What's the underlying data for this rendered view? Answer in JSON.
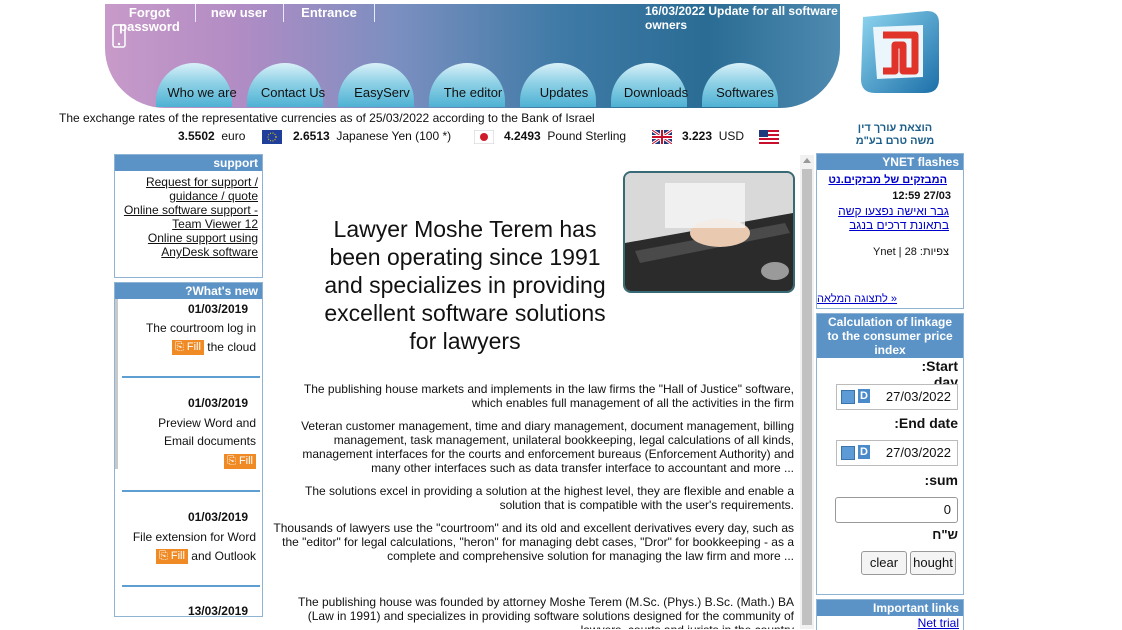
{
  "top_links": {
    "forgot_password": "Forgot password",
    "new_user": "new user",
    "entrance": "Entrance"
  },
  "update_notice": "16/03/2022 Update for all software owners",
  "tabs": [
    "Who we are",
    "Contact Us",
    "EasyServ",
    "The editor",
    "Updates",
    "Downloads",
    "Softwares"
  ],
  "logo": {
    "caption_line1": "הוצאת עורך דין",
    "caption_line2": "משה טרם בע\"מ"
  },
  "rates": {
    "title": "The exchange rates of the representative currencies as of 25/03/2022 according to the Bank of Israel",
    "items": [
      {
        "value": "3.5502",
        "name": "euro"
      },
      {
        "value": "2.6513",
        "name": "Japanese Yen (100 *)"
      },
      {
        "value": "4.2493",
        "name": "Pound Sterling"
      },
      {
        "value": "3.223",
        "name": "USD"
      }
    ]
  },
  "support": {
    "title": "support",
    "links": [
      "Request for support / guidance / quote",
      "Online software support - Team Viewer 12",
      "Online support using AnyDesk software"
    ]
  },
  "whats_new": {
    "title": "?What's new",
    "fill_label": "Fill",
    "items": [
      {
        "date": "01/03/2019",
        "line1": "The courtroom log in",
        "line2": "the cloud"
      },
      {
        "date": "01/03/2019",
        "line1": "Preview Word and",
        "line2": "Email documents"
      },
      {
        "date": "01/03/2019",
        "line1": "File extension for Word",
        "line2": "and Outlook"
      },
      {
        "date": "13/03/2019"
      }
    ]
  },
  "main": {
    "heading": "Lawyer Moshe Terem has been operating since 1991 and specializes in providing excellent software solutions for lawyers",
    "paragraphs": [
      "The publishing house markets and implements in the law firms the \"Hall of Justice\" software, which enables full management of all the activities in the firm",
      "Veteran customer management, time and diary management, document management, billing management, task management, unilateral bookkeeping, legal calculations of all kinds, management interfaces for the courts and enforcement bureaus (Enforcement Authority) and many other interfaces such as data transfer interface to accountant and more ...",
      "The solutions excel in providing a solution at the highest level, they are flexible and enable a solution that is compatible with the user's requirements.",
      "Thousands of lawyers use the \"courtroom\" and its old and excellent derivatives every day, such as the \"editor\" for legal calculations, \"heron\" for managing debt cases, \"Dror\" for bookkeeping - as a complete and comprehensive solution for managing the law firm and more ...",
      "The publishing house was founded by attorney Moshe Terem (M.Sc. (Phys.) B.Sc. (Math.) BA (Law in 1991) and specializes in providing software solutions designed for the community of lawyers, courts and jurists in the country"
    ]
  },
  "ynet": {
    "title": "YNET flashes",
    "source_link": "המבזקים של מבזקים.נט",
    "time": "12:59 27/03",
    "headline": "גבר ואישה נפצעו קשה בתאונת דרכים בנגב",
    "views": "Ynet | צפיות: 28",
    "full_view": "לתצוגה המלאה »"
  },
  "linkage": {
    "title": "Calculation of linkage to the consumer price index",
    "start_label": ":Start day",
    "start_value": "27/03/2022",
    "end_label": ":End date",
    "end_value": "27/03/2022",
    "sum_label": ":sum",
    "sum_value": "0",
    "currency": "ש\"ח",
    "clear_label": "clear",
    "calc_label": "hought",
    "date_badge": "D"
  },
  "important_links": {
    "title": "Important links",
    "first_link": "Net trial"
  },
  "colors": {
    "panel_header": "#5c93c7",
    "fill_badge": "#f08a24",
    "link_blue": "#0000cc"
  }
}
